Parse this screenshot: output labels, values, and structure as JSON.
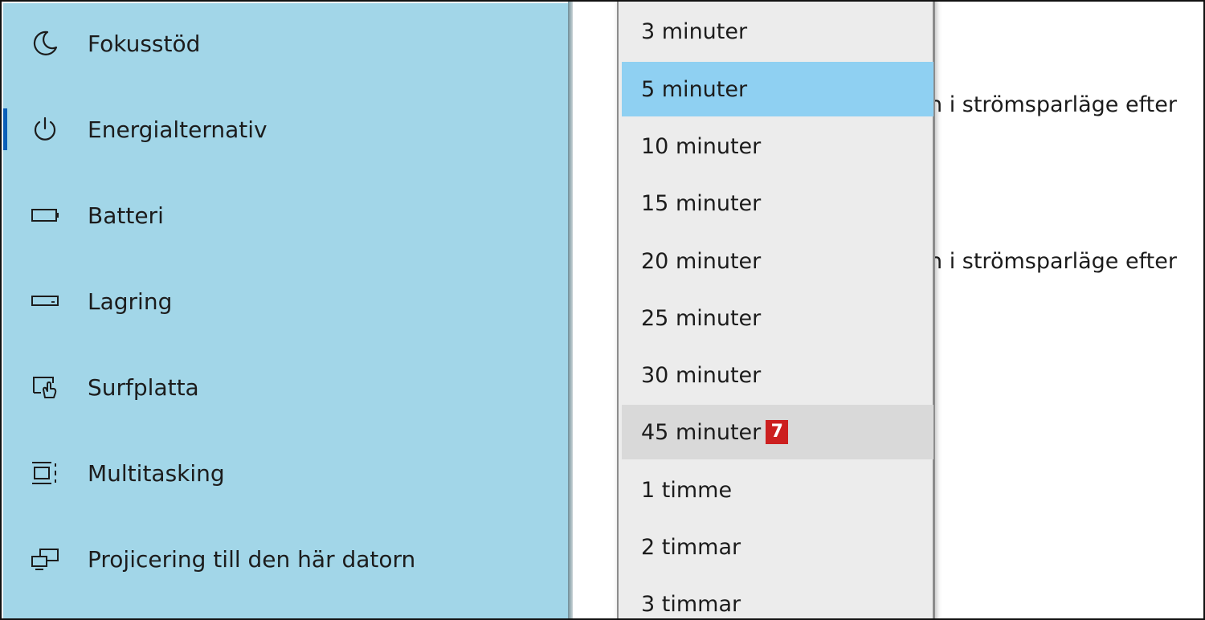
{
  "sidebar": {
    "items": [
      {
        "label": "Fokusstöd",
        "icon": "moon-icon"
      },
      {
        "label": "Energialternativ",
        "icon": "power-icon",
        "active": true
      },
      {
        "label": "Batteri",
        "icon": "battery-icon"
      },
      {
        "label": "Lagring",
        "icon": "storage-drive-icon"
      },
      {
        "label": "Surfplatta",
        "icon": "tablet-mode-icon"
      },
      {
        "label": "Multitasking",
        "icon": "multitasking-icon"
      },
      {
        "label": "Projicering till den här datorn",
        "icon": "projecting-icon"
      }
    ]
  },
  "content": {
    "line1_fragment": "n i strömsparläge efter",
    "line2_fragment": "n i strömsparläge efter"
  },
  "dropdown": {
    "options": [
      {
        "label": "3 minuter"
      },
      {
        "label": "5 minuter",
        "selected": true
      },
      {
        "label": "10 minuter"
      },
      {
        "label": "15 minuter"
      },
      {
        "label": "20 minuter"
      },
      {
        "label": "25 minuter"
      },
      {
        "label": "30 minuter"
      },
      {
        "label": "45 minuter",
        "hovered": true,
        "badge": "7"
      },
      {
        "label": "1 timme"
      },
      {
        "label": "2 timmar"
      },
      {
        "label": "3 timmar"
      }
    ]
  },
  "colors": {
    "sidebar_bg": "#a2d6e8",
    "selected_option_bg": "#8fd0f2",
    "hovered_option_bg": "#d9d9d9",
    "badge_bg": "#cc1f1f",
    "active_marker": "#0a5fb8"
  }
}
